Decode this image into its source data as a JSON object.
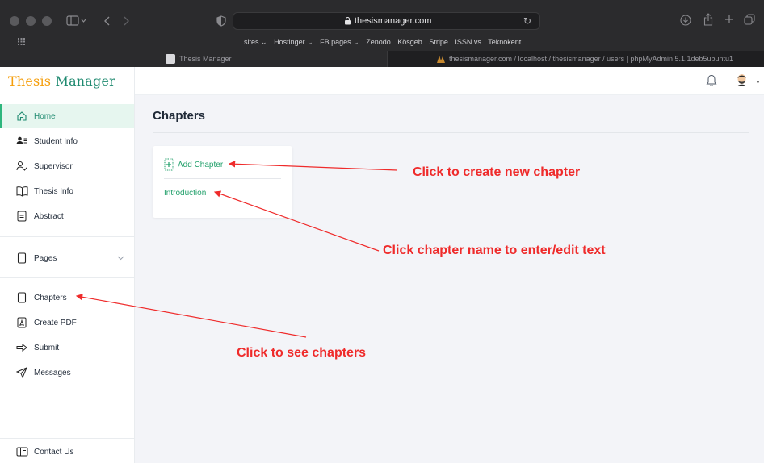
{
  "browser": {
    "url": "thesismanager.com",
    "bookmarks": [
      "sites ⌄",
      "Hostinger ⌄",
      "FB pages ⌄",
      "Zenodo",
      "Kösgeb",
      "Stripe",
      "ISSN vs",
      "Teknokent"
    ],
    "tabs": [
      {
        "title": "Thesis Manager"
      },
      {
        "title": "thesismanager.com / localhost / thesismanager / users | phpMyAdmin 5.1.1deb5ubuntu1"
      }
    ]
  },
  "app": {
    "brand_part1": "Thesis",
    "brand_part2": "Manager",
    "sidebar": {
      "items": [
        {
          "label": "Home"
        },
        {
          "label": "Student Info"
        },
        {
          "label": "Supervisor"
        },
        {
          "label": "Thesis Info"
        },
        {
          "label": "Abstract"
        },
        {
          "label": "Pages"
        },
        {
          "label": "Chapters"
        },
        {
          "label": "Create PDF"
        },
        {
          "label": "Submit"
        },
        {
          "label": "Messages"
        },
        {
          "label": "Contact Us"
        }
      ]
    },
    "page_title": "Chapters",
    "add_chapter_label": "Add Chapter",
    "chapters": [
      {
        "name": "Introduction"
      }
    ]
  },
  "annotations": {
    "create": "Click to create new chapter",
    "edit": "Click chapter name to enter/edit text",
    "see": "Click to see chapters"
  },
  "colors": {
    "accent_green": "#22a06b",
    "brand_orange": "#f59e0b",
    "annotation_red": "#ef2b2b"
  }
}
